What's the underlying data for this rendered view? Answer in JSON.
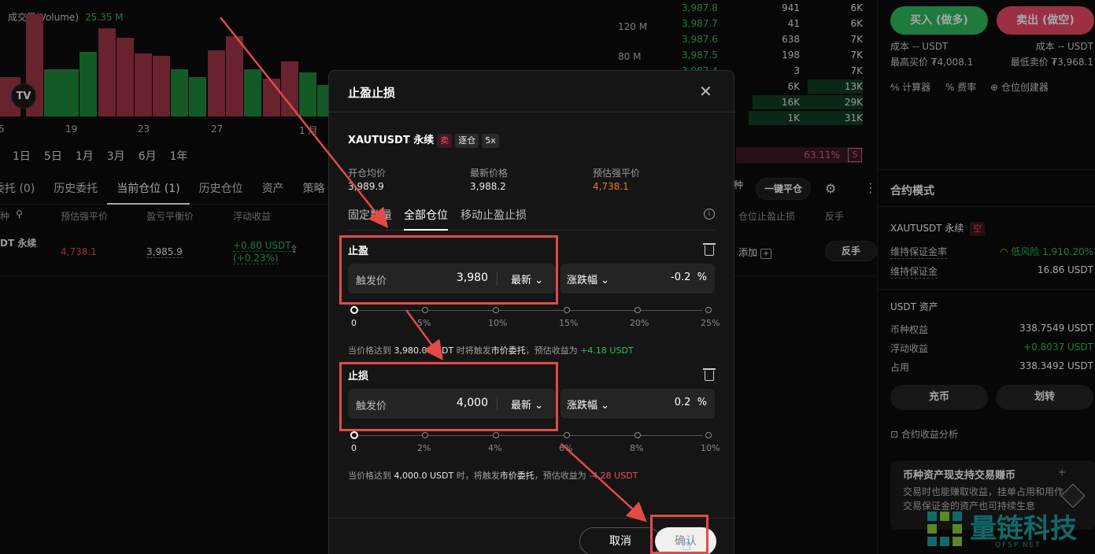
{
  "chart": {
    "volume_label": "成交量(Volume)",
    "volume_value": "25.35 M",
    "y_ticks": [
      "120 M",
      "80 M"
    ],
    "x_ticks": [
      "5",
      "19",
      "23",
      "27",
      "1 月"
    ],
    "ranges": [
      "1日",
      "5日",
      "1月",
      "3月",
      "6月",
      "1年"
    ],
    "tv_logo": "TV"
  },
  "tabs": [
    "委托 (0)",
    "历史委托",
    "当前仓位 (1)",
    "历史仓位",
    "资产",
    "策略"
  ],
  "columns": [
    "种",
    "预估强平价",
    "盈亏平衡价",
    "浮动收益"
  ],
  "position": {
    "symbol": "DT 永续",
    "liq": "4,738.1",
    "breakeven": "3,985.9",
    "pnl": "+0.80 USDT",
    "pnl_pct": "(+0.23%)",
    "add_label": "添加",
    "reverse_label": "反手"
  },
  "orderbook": [
    {
      "price": "3,987.8",
      "qty": "941",
      "cum": "6K"
    },
    {
      "price": "3,987.7",
      "qty": "41",
      "cum": "6K"
    },
    {
      "price": "3,987.6",
      "qty": "638",
      "cum": "7K"
    },
    {
      "price": "3,987.5",
      "qty": "198",
      "cum": "7K"
    },
    {
      "price": "3,987.4",
      "qty": "3",
      "cum": "7K"
    },
    {
      "price": "",
      "qty": "6K",
      "cum": "13K"
    },
    {
      "price": "",
      "qty": "16K",
      "cum": "29K"
    },
    {
      "price": "",
      "qty": "1K",
      "cum": "31K"
    }
  ],
  "ratio": {
    "value": "63.11%",
    "side": "S"
  },
  "right_tools": {
    "kind": "种",
    "close_all": "一键平仓",
    "col_tpsl": "仓位止盈止损",
    "col_rev": "反手"
  },
  "trade": {
    "buy": "买入 (做多)",
    "sell": "卖出 (做空)",
    "cost_left": "成本 -- USDT",
    "cost_right": "成本 -- USDT",
    "best_buy": "最高买价 ₮4,008.1",
    "best_sell": "最低卖价 ₮3,968.1",
    "tools": [
      "计算器",
      "费率",
      "仓位创建器"
    ]
  },
  "contract": {
    "title": "合约模式",
    "symbol": "XAUTUSDT 永续",
    "side_tag": "空",
    "mmr_label": "维持保证金率",
    "mmr_value": "低风险 1,910.20%",
    "mm_label": "维持保证金",
    "mm_value": "16.86 USDT"
  },
  "assets": {
    "title": "USDT 资产",
    "rows": [
      {
        "label": "币种权益",
        "value": "338.7549 USDT"
      },
      {
        "label": "浮动收益",
        "value": "+0.8037 USDT"
      },
      {
        "label": "占用",
        "value": "338.3492 USDT"
      }
    ],
    "deposit": "充币",
    "transfer": "划转",
    "analysis": "合约收益分析"
  },
  "promo": {
    "title": "币种资产现支持交易赚币",
    "desc": "交易时也能赚取收益，挂单占用和用作交易保证金的资产也可持续生息"
  },
  "watermark": {
    "cn": "量链科技",
    "en": "QFSP.NET"
  },
  "modal": {
    "title": "止盈止损",
    "symbol": "XAUTUSDT 永续",
    "tag_sell": "卖",
    "tag_mode": "逐仓",
    "tag_lev": "5x",
    "stats": [
      {
        "label": "开仓均价",
        "value": "3,989.9"
      },
      {
        "label": "最新价格",
        "value": "3,988.2"
      },
      {
        "label": "预估强平价",
        "value": "4,738.1"
      }
    ],
    "tabs": [
      "固定数量",
      "全部仓位",
      "移动止盈止损"
    ],
    "tp": {
      "title": "止盈",
      "trigger_label": "触发价",
      "trigger_value": "3,980",
      "price_type": "最新",
      "change_label": "涨跌幅",
      "change_value": "-0.2",
      "unit": "%",
      "marks": [
        "0",
        "5%",
        "10%",
        "15%",
        "20%",
        "25%"
      ],
      "hint_pre": "当价格达到",
      "hint_price": "3,980.0 USDT",
      "hint_mid": "时将触发",
      "hint_type": "市价委托",
      "hint_post": "，预估收益为",
      "hint_pnl": "+4.18 USDT"
    },
    "sl": {
      "title": "止损",
      "trigger_label": "触发价",
      "trigger_value": "4,000",
      "price_type": "最新",
      "change_label": "涨跌幅",
      "change_value": "0.2",
      "unit": "%",
      "marks": [
        "0",
        "2%",
        "4%",
        "6%",
        "8%",
        "10%"
      ],
      "hint_pre": "当价格达到",
      "hint_price": "4,000.0 USDT",
      "hint_mid": "时，将触发",
      "hint_type": "市价委托",
      "hint_post": "，预估收益为",
      "hint_pnl": "-4.28 USDT"
    },
    "cancel": "取消",
    "confirm": "确认"
  },
  "colors": {
    "green": "#2ebd5f",
    "red": "#ef4b6a",
    "highlight": "#e24a4a"
  }
}
